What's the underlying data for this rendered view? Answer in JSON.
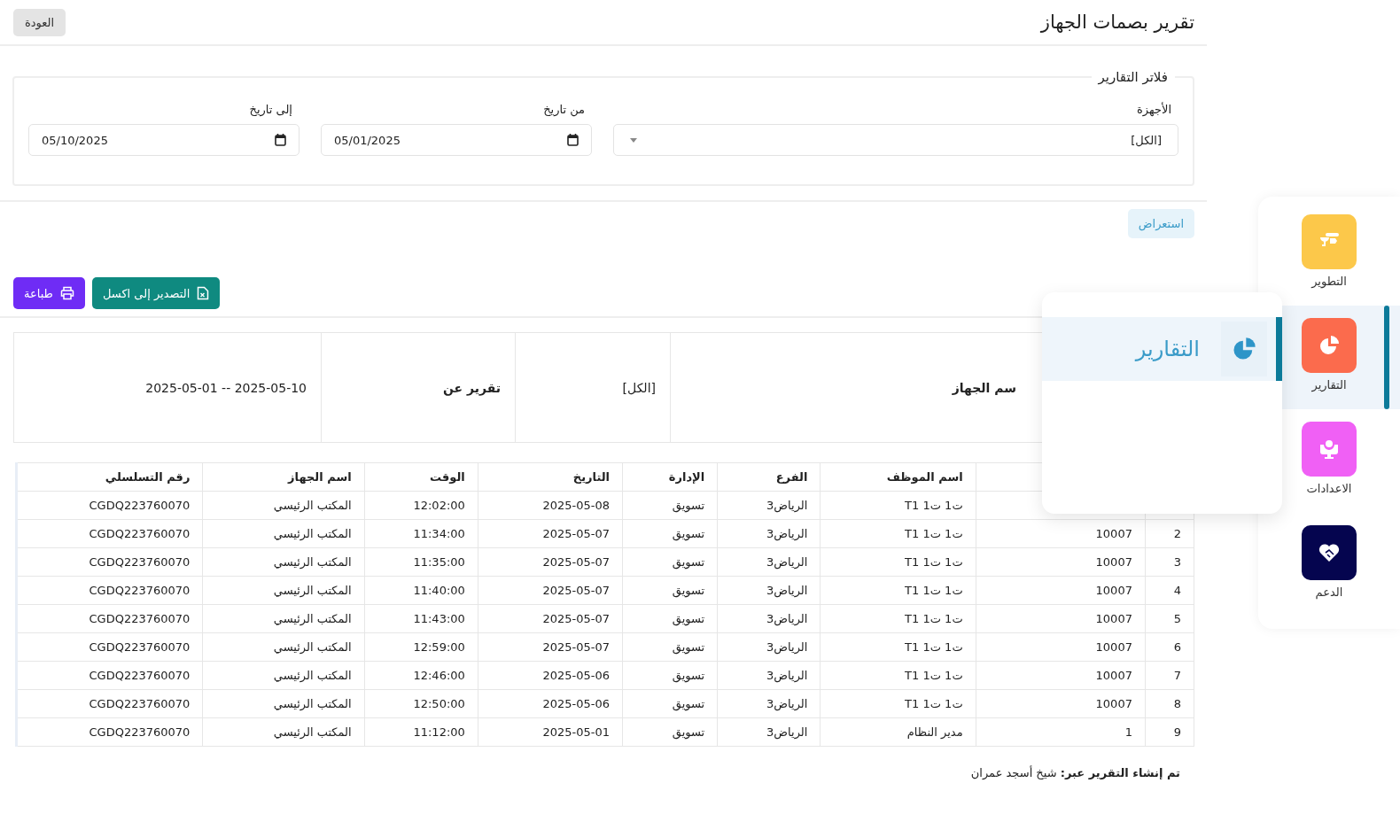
{
  "header": {
    "title": "تقرير بصمات الجهاز",
    "back_button": "العودة"
  },
  "filters": {
    "legend": "فلاتر التقارير",
    "devices": {
      "label": "الأجهزة",
      "value": "[الكل]"
    },
    "from": {
      "label": "من تاريخ",
      "value": "05/01/2025"
    },
    "to": {
      "label": "إلى تاريخ",
      "value": "05/10/2025"
    },
    "view_button": "استعراض"
  },
  "actions": {
    "export_button": "التصدير إلى اكسل",
    "print_button": "طباعة"
  },
  "report_info": {
    "device_label": "سم الجهاز",
    "device_value": "[الكل]",
    "period_label": "تقرير عن",
    "period_value": "2025-05-01 -- 2025-05-10"
  },
  "table": {
    "columns": [
      "اسم الموظف",
      "الفرع",
      "الإدارة",
      "التاريخ",
      "الوقت",
      "اسم الجهاز",
      "رقم التسلسلي"
    ],
    "rows": [
      {
        "cells": [
          "ت1 ت1 T1",
          "الرياض3",
          "تسويق",
          "2025-05-08",
          "12:02:00",
          "المكتب الرئيسي",
          "CGDQ223760070"
        ]
      },
      {
        "cells": [
          "2",
          "10007",
          "ت1 ت1 T1",
          "الرياض3",
          "تسويق",
          "2025-05-07",
          "11:34:00",
          "المكتب الرئيسي",
          "CGDQ223760070"
        ]
      },
      {
        "cells": [
          "3",
          "10007",
          "ت1 ت1 T1",
          "الرياض3",
          "تسويق",
          "2025-05-07",
          "11:35:00",
          "المكتب الرئيسي",
          "CGDQ223760070"
        ]
      },
      {
        "cells": [
          "4",
          "10007",
          "ت1 ت1 T1",
          "الرياض3",
          "تسويق",
          "2025-05-07",
          "11:40:00",
          "المكتب الرئيسي",
          "CGDQ223760070"
        ]
      },
      {
        "cells": [
          "5",
          "10007",
          "ت1 ت1 T1",
          "الرياض3",
          "تسويق",
          "2025-05-07",
          "11:43:00",
          "المكتب الرئيسي",
          "CGDQ223760070"
        ]
      },
      {
        "cells": [
          "6",
          "10007",
          "ت1 ت1 T1",
          "الرياض3",
          "تسويق",
          "2025-05-07",
          "12:59:00",
          "المكتب الرئيسي",
          "CGDQ223760070"
        ]
      },
      {
        "cells": [
          "7",
          "10007",
          "ت1 ت1 T1",
          "الرياض3",
          "تسويق",
          "2025-05-06",
          "12:46:00",
          "المكتب الرئيسي",
          "CGDQ223760070"
        ]
      },
      {
        "cells": [
          "8",
          "10007",
          "ت1 ت1 T1",
          "الرياض3",
          "تسويق",
          "2025-05-06",
          "12:50:00",
          "المكتب الرئيسي",
          "CGDQ223760070"
        ]
      },
      {
        "cells": [
          "9",
          "1",
          "مدير النظام",
          "الرياض3",
          "تسويق",
          "2025-05-01",
          "11:12:00",
          "المكتب الرئيسي",
          "CGDQ223760070"
        ]
      }
    ]
  },
  "footer": "**تم إنشاء التقرير عبر:** شيخ أسجد عمران",
  "sidebar": {
    "items": [
      {
        "label": "التطوير",
        "color": "#fcc84a",
        "selected": false
      },
      {
        "label": "التقارير",
        "color": "#fb6b4d",
        "selected": true
      },
      {
        "label": "الاعدادات",
        "color": "#f060f5",
        "selected": false
      },
      {
        "label": "الدعم",
        "color": "#05054f",
        "selected": false
      }
    ]
  },
  "flyout": {
    "label": "التقارير",
    "selected": true
  }
}
